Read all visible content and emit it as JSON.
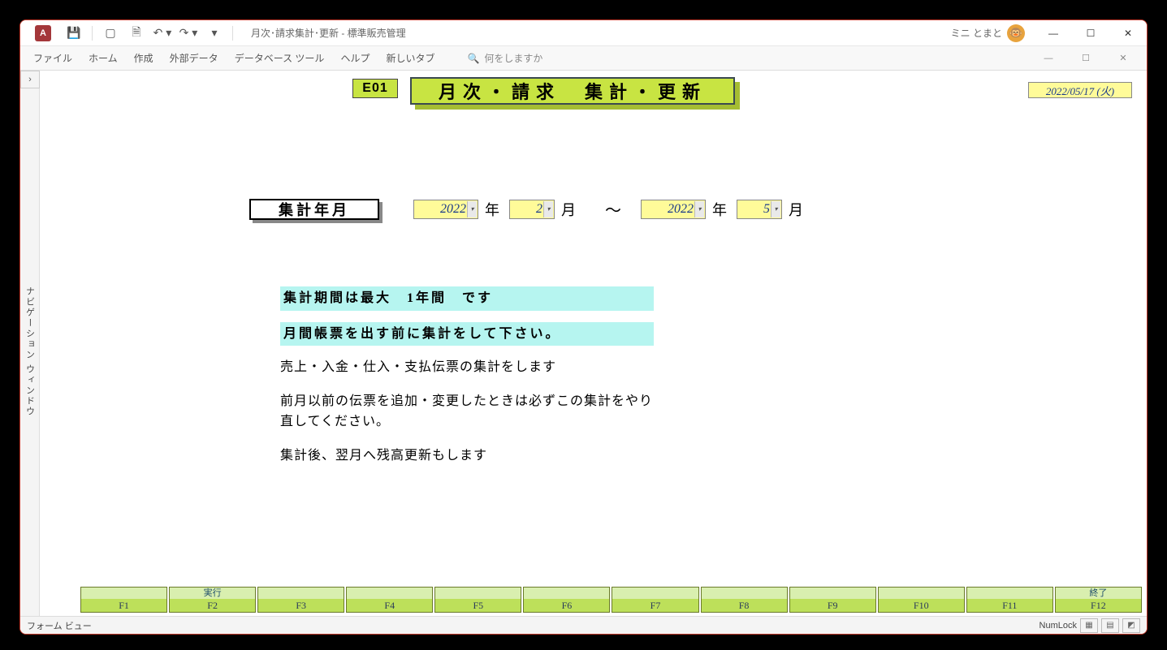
{
  "titlebar": {
    "title": "月次･請求集計･更新  -  標準販売管理",
    "user": "ミニ とまと"
  },
  "ribbon": {
    "tabs": [
      "ファイル",
      "ホーム",
      "作成",
      "外部データ",
      "データベース ツール",
      "ヘルプ",
      "新しいタブ"
    ],
    "search_placeholder": "何をしますか"
  },
  "nav_pane_label": "ナビゲーション ウィンドウ",
  "header": {
    "code": "E01",
    "title": "月次・請求　集計・更新",
    "date": "2022/05/17 (火)"
  },
  "period": {
    "label": "集計年月",
    "from_year": "2022",
    "from_month": "2",
    "to_year": "2022",
    "to_month": "5",
    "year_unit": "年",
    "month_unit": "月",
    "range_sep": "～"
  },
  "info": {
    "hl1": "集計期間は最大　1年間　です",
    "hl2": "月間帳票を出す前に集計をして下さい。",
    "line1": "売上・入金・仕入・支払伝票の集計をします",
    "line2": "前月以前の伝票を追加・変更したときは必ずこの集計をやり直してください。",
    "line3": "集計後、翌月へ残高更新もします"
  },
  "fkeys": {
    "labels": [
      "",
      "実行",
      "",
      "",
      "",
      "",
      "",
      "",
      "",
      "",
      "",
      "終了"
    ],
    "keys": [
      "F1",
      "F2",
      "F3",
      "F4",
      "F5",
      "F6",
      "F7",
      "F8",
      "F9",
      "F10",
      "F11",
      "F12"
    ]
  },
  "statusbar": {
    "left": "フォーム ビュー",
    "numlock": "NumLock"
  }
}
